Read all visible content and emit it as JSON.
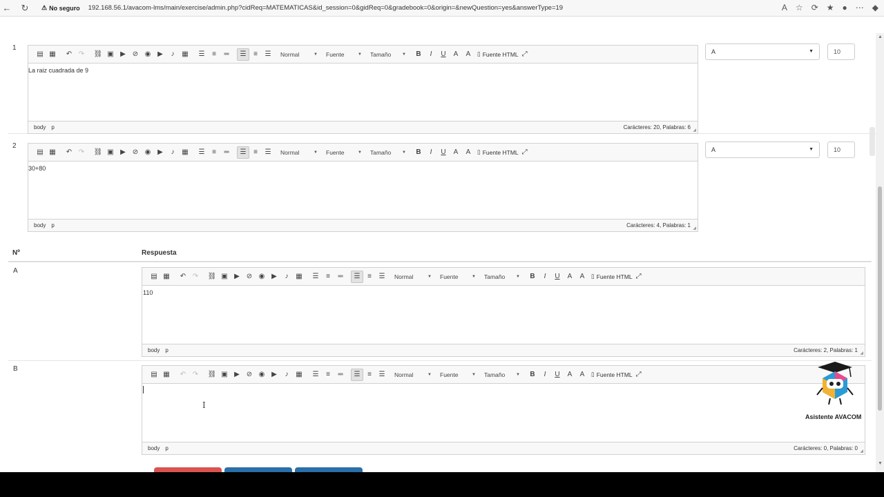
{
  "browser": {
    "security_label": "No seguro",
    "url": "192.168.56.1/avacom-lms/main/exercise/admin.php?cidReq=MATEMATICAS&id_session=0&gidReq=0&gradebook=0&origin=&newQuestion=yes&answerType=19"
  },
  "editor_toolbar": {
    "format_label": "Normal",
    "font_label": "Fuente",
    "size_label": "Tamaño",
    "source_label": "Fuente HTML",
    "icons": [
      "paste-icon",
      "paste-word-icon",
      "undo-icon",
      "redo-icon",
      "link-icon",
      "image-icon",
      "video-icon",
      "flash-icon",
      "media-icon",
      "youtube-icon",
      "audio-icon",
      "table-icon",
      "bulleted-list-icon",
      "numbered-list-icon",
      "horizontal-rule-icon",
      "align-left-icon",
      "align-center-icon",
      "align-right-icon",
      "bold-icon",
      "italic-icon",
      "underline-icon",
      "text-color-icon",
      "bg-color-icon",
      "source-icon",
      "maximize-icon"
    ]
  },
  "questions": [
    {
      "number": "1",
      "text": "La raiz cuadrada de 9",
      "path_body": "body",
      "path_p": "p",
      "count": "Carácteres: 20, Palabras: 6",
      "answer": "A",
      "weight": "10"
    },
    {
      "number": "2",
      "text": "30+80",
      "path_body": "body",
      "path_p": "p",
      "count": "Carácteres: 4, Palabras: 1",
      "answer": "A",
      "weight": "10"
    }
  ],
  "answers_header": {
    "col_num": "Nº",
    "col_answer": "Respuesta"
  },
  "answers": [
    {
      "letter": "A",
      "text": "110",
      "path_body": "body",
      "path_p": "p",
      "count": "Carácteres: 2, Palabras: 1"
    },
    {
      "letter": "B",
      "text": "",
      "path_body": "body",
      "path_p": "p",
      "count": "Carácteres: 0, Palabras: 0"
    }
  ],
  "assistant": {
    "label": "Asistente AVACOM"
  },
  "colors": {
    "danger": "#d9534f",
    "primary": "#2a6fa8"
  }
}
